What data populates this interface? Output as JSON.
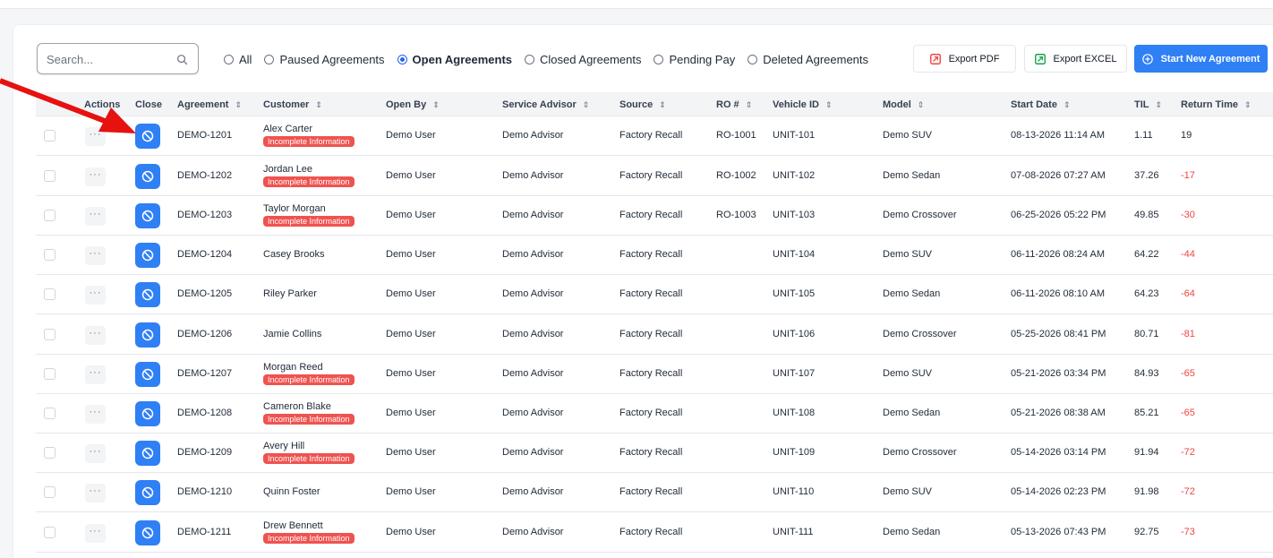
{
  "search": {
    "placeholder": "Search..."
  },
  "filters": [
    {
      "label": "All",
      "checked": false
    },
    {
      "label": "Paused Agreements",
      "checked": false
    },
    {
      "label": "Open Agreements",
      "checked": true
    },
    {
      "label": "Closed Agreements",
      "checked": false
    },
    {
      "label": "Pending Pay",
      "checked": false
    },
    {
      "label": "Deleted Agreements",
      "checked": false
    }
  ],
  "toolbar": {
    "export_pdf": "Export PDF",
    "export_excel": "Export EXCEL",
    "start_new": "Start New Agreement"
  },
  "columns": {
    "actions": "Actions",
    "close": "Close",
    "agreement": "Agreement",
    "customer": "Customer",
    "open_by": "Open By",
    "service_advisor": "Service Advisor",
    "source": "Source",
    "ro": "RO #",
    "vehicle_id": "Vehicle ID",
    "model": "Model",
    "start_date": "Start Date",
    "til": "TIL",
    "return_time": "Return Time"
  },
  "badge_text": "Incomplete Information",
  "actions_glyph": "···",
  "rows": [
    {
      "agreement": "DEMO-1201",
      "customer": "Alex Carter",
      "incomplete": true,
      "open_by": "Demo User",
      "advisor": "Demo Advisor",
      "source": "Factory Recall",
      "ro": "RO-1001",
      "vehicle": "UNIT-101",
      "model": "Demo SUV",
      "start": "08-13-2026 11:14 AM",
      "til": "1.11",
      "ret": "19"
    },
    {
      "agreement": "DEMO-1202",
      "customer": "Jordan Lee",
      "incomplete": true,
      "open_by": "Demo User",
      "advisor": "Demo Advisor",
      "source": "Factory Recall",
      "ro": "RO-1002",
      "vehicle": "UNIT-102",
      "model": "Demo Sedan",
      "start": "07-08-2026 07:27 AM",
      "til": "37.26",
      "ret": "-17"
    },
    {
      "agreement": "DEMO-1203",
      "customer": "Taylor Morgan",
      "incomplete": true,
      "open_by": "Demo User",
      "advisor": "Demo Advisor",
      "source": "Factory Recall",
      "ro": "RO-1003",
      "vehicle": "UNIT-103",
      "model": "Demo Crossover",
      "start": "06-25-2026 05:22 PM",
      "til": "49.85",
      "ret": "-30"
    },
    {
      "agreement": "DEMO-1204",
      "customer": "Casey Brooks",
      "incomplete": false,
      "open_by": "Demo User",
      "advisor": "Demo Advisor",
      "source": "Factory Recall",
      "ro": "",
      "vehicle": "UNIT-104",
      "model": "Demo SUV",
      "start": "06-11-2026 08:24 AM",
      "til": "64.22",
      "ret": "-44"
    },
    {
      "agreement": "DEMO-1205",
      "customer": "Riley Parker",
      "incomplete": false,
      "open_by": "Demo User",
      "advisor": "Demo Advisor",
      "source": "Factory Recall",
      "ro": "",
      "vehicle": "UNIT-105",
      "model": "Demo Sedan",
      "start": "06-11-2026 08:10 AM",
      "til": "64.23",
      "ret": "-64"
    },
    {
      "agreement": "DEMO-1206",
      "customer": "Jamie Collins",
      "incomplete": false,
      "open_by": "Demo User",
      "advisor": "Demo Advisor",
      "source": "Factory Recall",
      "ro": "",
      "vehicle": "UNIT-106",
      "model": "Demo Crossover",
      "start": "05-25-2026 08:41 PM",
      "til": "80.71",
      "ret": "-81"
    },
    {
      "agreement": "DEMO-1207",
      "customer": "Morgan Reed",
      "incomplete": true,
      "open_by": "Demo User",
      "advisor": "Demo Advisor",
      "source": "Factory Recall",
      "ro": "",
      "vehicle": "UNIT-107",
      "model": "Demo SUV",
      "start": "05-21-2026 03:34 PM",
      "til": "84.93",
      "ret": "-65"
    },
    {
      "agreement": "DEMO-1208",
      "customer": "Cameron Blake",
      "incomplete": true,
      "open_by": "Demo User",
      "advisor": "Demo Advisor",
      "source": "Factory Recall",
      "ro": "",
      "vehicle": "UNIT-108",
      "model": "Demo Sedan",
      "start": "05-21-2026 08:38 AM",
      "til": "85.21",
      "ret": "-65"
    },
    {
      "agreement": "DEMO-1209",
      "customer": "Avery Hill",
      "incomplete": true,
      "open_by": "Demo User",
      "advisor": "Demo Advisor",
      "source": "Factory Recall",
      "ro": "",
      "vehicle": "UNIT-109",
      "model": "Demo Crossover",
      "start": "05-14-2026 03:14 PM",
      "til": "91.94",
      "ret": "-72"
    },
    {
      "agreement": "DEMO-1210",
      "customer": "Quinn Foster",
      "incomplete": false,
      "open_by": "Demo User",
      "advisor": "Demo Advisor",
      "source": "Factory Recall",
      "ro": "",
      "vehicle": "UNIT-110",
      "model": "Demo SUV",
      "start": "05-14-2026 02:23 PM",
      "til": "91.98",
      "ret": "-72"
    },
    {
      "agreement": "DEMO-1211",
      "customer": "Drew Bennett",
      "incomplete": true,
      "open_by": "Demo User",
      "advisor": "Demo Advisor",
      "source": "Factory Recall",
      "ro": "",
      "vehicle": "UNIT-111",
      "model": "Demo Sedan",
      "start": "05-13-2026 07:43 PM",
      "til": "92.75",
      "ret": "-73"
    }
  ]
}
